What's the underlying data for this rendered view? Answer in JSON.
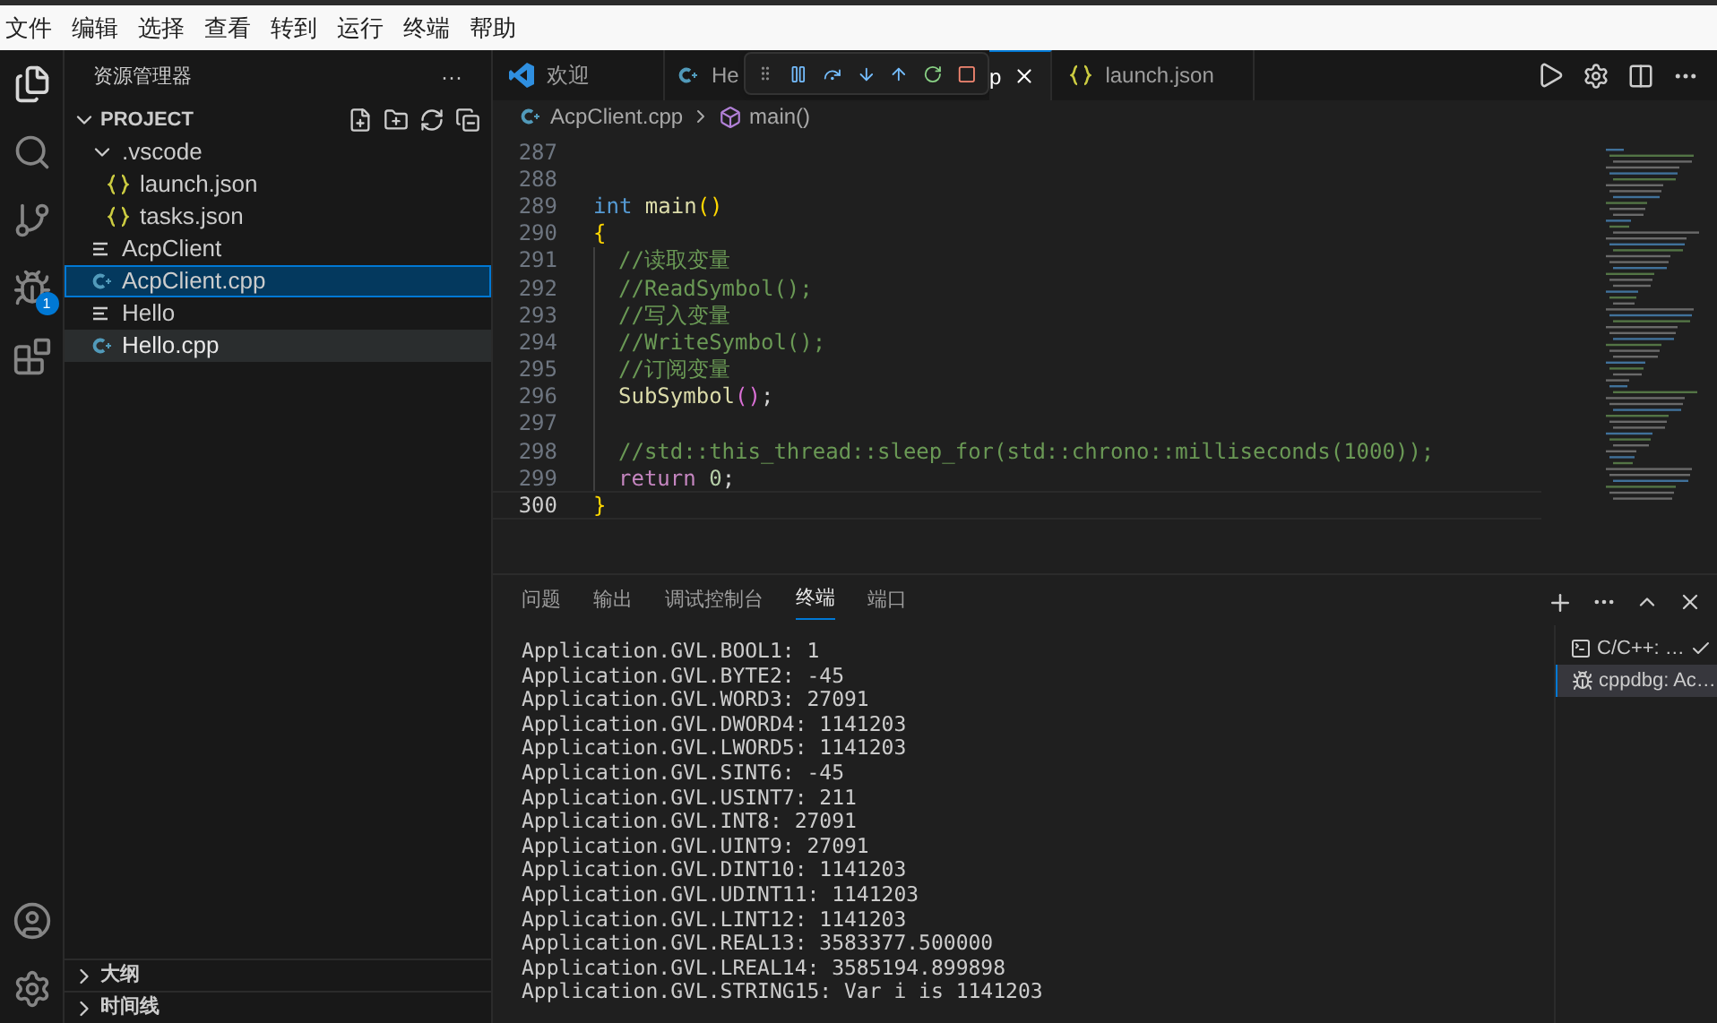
{
  "menu_bar": [
    "文件",
    "编辑",
    "选择",
    "查看",
    "转到",
    "运行",
    "终端",
    "帮助"
  ],
  "activity_bar": {
    "debug_badge": "1"
  },
  "sidebar": {
    "title": "资源管理器",
    "more": "···",
    "section": "PROJECT",
    "tree": [
      {
        "label": ".vscode",
        "kind": "folder",
        "expanded": true,
        "selected": false,
        "highlighted": false,
        "children": [
          {
            "label": "launch.json",
            "kind": "json",
            "selected": false,
            "highlighted": false
          },
          {
            "label": "tasks.json",
            "kind": "json",
            "selected": false,
            "highlighted": false
          }
        ]
      },
      {
        "label": "AcpClient",
        "kind": "binary",
        "selected": false,
        "highlighted": false
      },
      {
        "label": "AcpClient.cpp",
        "kind": "cpp",
        "selected": true,
        "highlighted": false
      },
      {
        "label": "Hello",
        "kind": "binary",
        "selected": false,
        "highlighted": false
      },
      {
        "label": "Hello.cpp",
        "kind": "cpp",
        "selected": false,
        "highlighted": true
      }
    ],
    "bottom_sections": [
      "大纲",
      "时间线"
    ]
  },
  "tabs": [
    {
      "label": "欢迎",
      "kind": "welcome",
      "selected": false
    },
    {
      "label": "He",
      "kind": "cpp",
      "selected": false
    },
    {
      "label": "p",
      "selected": true
    },
    {
      "label": "launch.json",
      "kind": "json",
      "selected": false
    }
  ],
  "breadcrumb": [
    "AcpClient.cpp",
    "main()"
  ],
  "code": [
    {
      "n": "287",
      "current": false,
      "guide": false
    },
    {
      "n": "288",
      "current": false,
      "guide": false
    },
    {
      "n": "289",
      "current": false,
      "guide": false,
      "tokens": [
        {
          "kind": "keyword",
          "text": "int"
        },
        {
          "kind": "func",
          "text": "main"
        },
        {
          "kind": "bracket",
          "text": "()"
        }
      ]
    },
    {
      "n": "290",
      "current": false,
      "guide": false,
      "tokens": [
        {
          "kind": "bracket",
          "text": "{"
        }
      ]
    },
    {
      "n": "291",
      "current": false,
      "guide": true,
      "tokens": [
        {
          "kind": "comment",
          "text": "//读取变量"
        }
      ]
    },
    {
      "n": "292",
      "current": false,
      "guide": true,
      "tokens": [
        {
          "kind": "comment",
          "text": "//ReadSymbol();"
        }
      ]
    },
    {
      "n": "293",
      "current": false,
      "guide": true,
      "tokens": [
        {
          "kind": "comment",
          "text": "//写入变量"
        }
      ]
    },
    {
      "n": "294",
      "current": false,
      "guide": true,
      "tokens": [
        {
          "kind": "comment",
          "text": "//WriteSymbol();"
        }
      ]
    },
    {
      "n": "295",
      "current": false,
      "guide": true,
      "tokens": [
        {
          "kind": "comment",
          "text": "//订阅变量"
        }
      ]
    },
    {
      "n": "296",
      "current": false,
      "guide": true,
      "tokens": [
        {
          "kind": "func",
          "text": "SubSymbol"
        },
        {
          "kind": "paren",
          "text": "()"
        },
        {
          "kind": "plain",
          "text": ";"
        }
      ]
    },
    {
      "n": "297",
      "current": false,
      "guide": true
    },
    {
      "n": "298",
      "current": false,
      "guide": true,
      "tokens": [
        {
          "kind": "comment",
          "text": "//std::this_thread::sleep_for(std::chrono::milliseconds(1000));"
        }
      ]
    },
    {
      "n": "299",
      "current": false,
      "guide": true,
      "tokens": [
        {
          "kind": "control",
          "text": "return"
        },
        {
          "kind": "number",
          "text": "0"
        },
        {
          "kind": "plain",
          "text": ";"
        }
      ]
    },
    {
      "n": "300",
      "current": true,
      "guide": false,
      "tokens": [
        {
          "kind": "bracket",
          "text": "}"
        }
      ]
    }
  ],
  "panel": {
    "tabs": [
      {
        "label": "问题",
        "selected": false
      },
      {
        "label": "输出",
        "selected": false
      },
      {
        "label": "调试控制台",
        "selected": false
      },
      {
        "label": "终端",
        "selected": true
      },
      {
        "label": "端口",
        "selected": false
      }
    ],
    "terminal_lines": [
      "Application.GVL.BOOL1: 1",
      "Application.GVL.BYTE2: -45",
      "Application.GVL.WORD3: 27091",
      "Application.GVL.DWORD4: 1141203",
      "Application.GVL.LWORD5: 1141203",
      "Application.GVL.SINT6: -45",
      "Application.GVL.USINT7: 211",
      "Application.GVL.INT8: 27091",
      "Application.GVL.UINT9: 27091",
      "Application.GVL.DINT10: 1141203",
      "Application.GVL.UDINT11: 1141203",
      "Application.GVL.LINT12: 1141203",
      "Application.GVL.REAL13: 3583377.500000",
      "Application.GVL.LREAL14: 3585194.899898",
      "Application.GVL.STRING15: Var i is 1141203"
    ],
    "terminals": [
      {
        "label": "C/C++: …",
        "kind": "shell",
        "selected": false,
        "done": true
      },
      {
        "label": "cppdbg: Ac…",
        "kind": "debug",
        "selected": true,
        "done": false
      }
    ]
  }
}
